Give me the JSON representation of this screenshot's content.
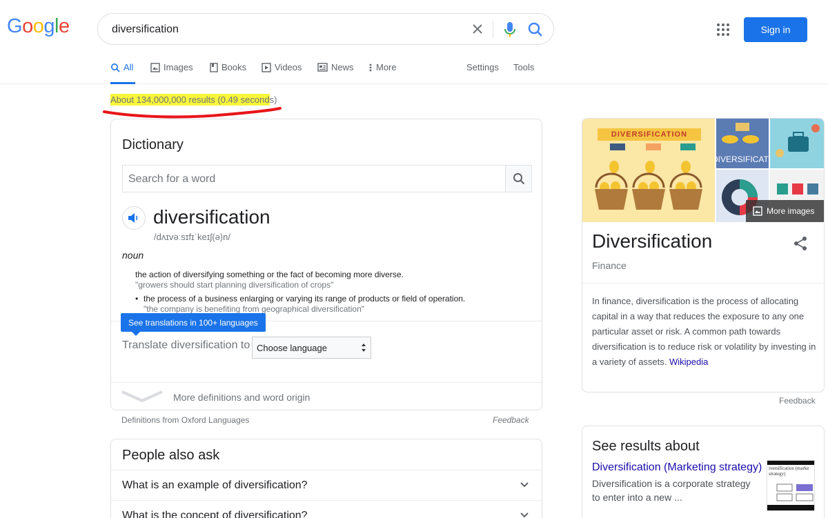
{
  "logo": {
    "letters": [
      "G",
      "o",
      "o",
      "g",
      "l",
      "e"
    ],
    "colors": [
      "#4285f4",
      "#ea4335",
      "#fbbc05",
      "#4285f4",
      "#34a853",
      "#ea4335"
    ]
  },
  "search": {
    "query": "diversification"
  },
  "header": {
    "signin_label": "Sign in"
  },
  "tabs": [
    {
      "label": "All",
      "icon": "search-icon"
    },
    {
      "label": "Images",
      "icon": "image-icon"
    },
    {
      "label": "Books",
      "icon": "book-icon"
    },
    {
      "label": "Videos",
      "icon": "play-icon"
    },
    {
      "label": "News",
      "icon": "news-icon"
    },
    {
      "label": "More",
      "icon": "more-vert-icon"
    },
    {
      "label": "Settings"
    },
    {
      "label": "Tools"
    }
  ],
  "stats": {
    "text_highlighted": "About 134,000,000 results (0.49 second",
    "text_tail": "s)"
  },
  "dictionary": {
    "heading": "Dictionary",
    "search_placeholder": "Search for a word",
    "word": "diversification",
    "phonetic": "/dʌɪvəːsɪfɪˈkeɪʃ(ə)n/",
    "part_of_speech": "noun",
    "definitions": [
      {
        "text": "the action of diversifying something or the fact of becoming more diverse.",
        "example": "\"growers should start planning diversification of crops\""
      },
      {
        "text": "the process of a business enlarging or varying its range of products or field of operation.",
        "example": "\"the company is benefiting from geographical diversification\""
      }
    ],
    "bullet": "•",
    "translations_tooltip": "See translations in 100+ languages",
    "translate_label": "Translate diversification to",
    "language_select": "Choose language",
    "more_link": "More definitions and word origin",
    "source": "Definitions from Oxford Languages",
    "feedback": "Feedback"
  },
  "people_also_ask": {
    "heading": "People also ask",
    "questions": [
      "What is an example of diversification?",
      "What is the concept of diversification?"
    ]
  },
  "knowledge_panel": {
    "image_banner": "DIVERSIFICATION",
    "image_b_text": "DIVERSIFICATIO",
    "more_images": "More images",
    "title": "Diversification",
    "subtitle": "Finance",
    "description": "In finance, diversification is the process of allocating capital in a way that reduces the exposure to any one particular asset or risk. A common path towards diversification is to reduce risk or volatility by investing in a variety of assets.",
    "source_link": "Wikipedia",
    "feedback": "Feedback"
  },
  "see_results": {
    "heading": "See results about",
    "link": "Diversification (Marketing strategy)",
    "description": "Diversification is a corporate strategy to enter into a new ...",
    "thumb_text": "iversification (marke strategy)"
  },
  "colors": {
    "accent": "#1a73e8",
    "link": "#1a0dab",
    "highlight": "#f7f63a",
    "annotation": "#e8161a"
  }
}
